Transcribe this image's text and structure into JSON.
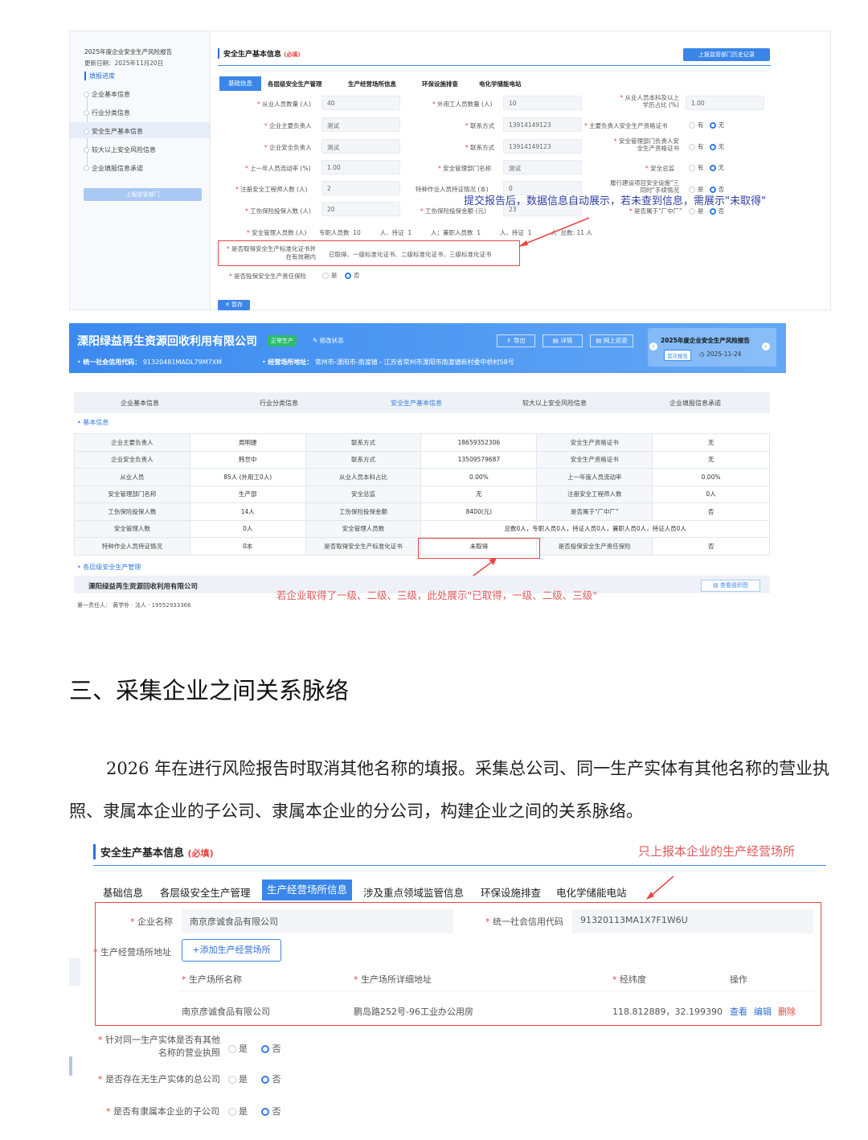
{
  "shot1": {
    "report_title": "2025年度企业安全生产风险报告",
    "update_date": "更新日期：2025年11月20日",
    "progress_title": "填报进度",
    "steps": [
      "企业基本信息",
      "行业分类信息",
      "安全生产基本信息",
      "较大以上安全风险信息",
      "企业填报信息承诺"
    ],
    "submit_btn": "上报监管部门",
    "section_title": "安全生产基本信息",
    "required": "(必填)",
    "history_btn": "上报监管部门历史记录",
    "tabs": [
      "基础信息",
      "各层级安全生产管理",
      "生产经营场所信息",
      "环保设施排查",
      "电化学储能电站"
    ],
    "rows": [
      [
        {
          "label": "从业人员数量 (人)",
          "value": "40"
        },
        {
          "label": "外用工人员数量 (人)",
          "value": "10"
        },
        {
          "label": "从业人员本科及以上学历占比 (%)",
          "value": "1.00"
        }
      ],
      [
        {
          "label": "企业主要负责人",
          "value": "测试"
        },
        {
          "label": "联系方式",
          "value": "13914149123"
        },
        {
          "label": "主要负责人安全生产资格证书",
          "value": ""
        }
      ],
      [
        {
          "label": "企业安全负责人",
          "value": "测试"
        },
        {
          "label": "联系方式",
          "value": "13914149123"
        },
        {
          "label": "安全管理部门负责人安全生产资格证书",
          "value": ""
        }
      ],
      [
        {
          "label": "上一年人员流动率 (%)",
          "value": "1.00"
        },
        {
          "label": "安全管理部门名称",
          "value": "测试"
        },
        {
          "label": "安全总监",
          "value": ""
        }
      ],
      [
        {
          "label": "注册安全工程师人数 (人)",
          "value": "2"
        },
        {
          "label": "特种作业人员持证情况 (本)",
          "value": "0"
        },
        {
          "label": "履行建设项目安全设施\"三同时\"手续情况",
          "value": ""
        }
      ],
      [
        {
          "label": "工伤保险投保人数 (人)",
          "value": "20"
        },
        {
          "label": "工伤保险投保金额 (元)",
          "value": "23"
        },
        {
          "label": "是否属于\"厂中厂\"",
          "value": ""
        }
      ]
    ],
    "yes": "有",
    "no": "无",
    "shi": "是",
    "fou": "否",
    "mgmt_label": "安全管理人员数 (人)",
    "mgmt_text": "专职人员数  10          人、持证  1          人；兼职人员数  1          人、持证  1          人  总数: 11 人",
    "std_label": "是否取得安全生产标准化证书并在有效期内",
    "std_options": "已取得、一级标准化证书、二级标准化证书、三级标准化证书",
    "insure_label": "是否投保安全生产责任保险",
    "save_btn": "暂存",
    "note": "提交报告后，数据信息自动展示，若未查到信息，需展示\"未取得\""
  },
  "shot2": {
    "company": "溧阳绿益再生资源回收利用有限公司",
    "status_badge": "正常生产",
    "modify_status": "修改状态",
    "credit_code_label": "统一社会信用代码：",
    "credit_code": "91320481MADL79M7XM",
    "address_label": "经营场所地址：",
    "address": "常州市-溧阳市-南渡镇 - 江苏省常州市溧阳市南渡镇新村委中桥村58号",
    "btn_prev": "导出",
    "btn_detail": "详情",
    "btn_online": "网上巡查",
    "report_title": "2025年度企业安全生产风险报告",
    "first_report": "首次报告",
    "report_date": "2025-11-24",
    "tabs": [
      "企业基本信息",
      "行业分类信息",
      "安全生产基本信息",
      "较大以上安全风险信息",
      "企业填报信息承诺"
    ],
    "basic_info": "基本信息",
    "table": [
      [
        "企业主要负责人",
        "周明捷",
        "联系方式",
        "18659352306",
        "安全生产资格证书",
        "无"
      ],
      [
        "企业安全负责人",
        "韩世中",
        "联系方式",
        "13509579687",
        "安全生产资格证书",
        "无"
      ],
      [
        "从业人员",
        "85人 (外用工0人)",
        "从业人员本科占比",
        "0.00%",
        "上一年度人员流动率",
        "0.00%"
      ],
      [
        "安全管理部门名称",
        "生产部",
        "安全总监",
        "无",
        "注册安全工程师人数",
        "0人"
      ],
      [
        "工伤保险投保人数",
        "14人",
        "工伤保险投保金额",
        "8400(元)",
        "是否属于\"厂中厂\"",
        "否"
      ]
    ],
    "mgmt_row": [
      "安全管理人数",
      "0人",
      "安全管理人员数",
      "总数0人，专职人员0人，持证人员0人，兼职人员0人，持证人员0人"
    ],
    "last_row": [
      "特种作业人员持证情况",
      "0本",
      "是否取得安全生产标准化证书",
      "未取得",
      "是否投保安全生产责任保险",
      "否"
    ],
    "level_mgmt": "各层级安全生产管理",
    "sub_company": "溧阳绿益再生资源回收利用有限公司",
    "first_person": "第一责任人：  黄学朴  · 法人 · 19552933366",
    "view_org": "查看组织图",
    "note": "若企业取得了一级、二级、三级，此处展示\"已取得，一级、二级、三级\""
  },
  "heading": "三、采集企业之间关系脉络",
  "paragraph": "2026 年在进行风险报告时取消其他名称的填报。采集总公司、同一生产实体有其他名称的营业执照、隶属本企业的子公司、隶属本企业的分公司，构建企业之间的关系脉络。",
  "shot3": {
    "section_title": "安全生产基本信息",
    "required": "(必填)",
    "note": "只上报本企业的生产经营场所",
    "tabs": [
      "基础信息",
      "各层级安全生产管理",
      "生产经营场所信息",
      "涉及重点领域监管信息",
      "环保设施排查",
      "电化学储能电站"
    ],
    "company_label": "企业名称",
    "company_value": "南京彦诚食品有限公司",
    "credit_label": "统一社会信用代码",
    "credit_value": "91320113MA1X7F1W6U",
    "site_label": "生产经营场所地址",
    "add_site_btn": "+添加生产经营场所",
    "columns": [
      "生产场所名称",
      "生产场所详细地址",
      "经纬度",
      "操作"
    ],
    "site_row": {
      "name": "南京彦诚食品有限公司",
      "address": "鹏岛路252号-96工业办公用房",
      "coords": "118.812889，32.199390",
      "view": "查看",
      "edit": "编辑",
      "delete": "删除"
    },
    "q1": "针对同一生产实体是否有其他名称的营业执照",
    "q2": "是否存在无生产实体的总公司",
    "q3": "是否有隶属本企业的子公司",
    "yes": "是",
    "no": "否"
  }
}
